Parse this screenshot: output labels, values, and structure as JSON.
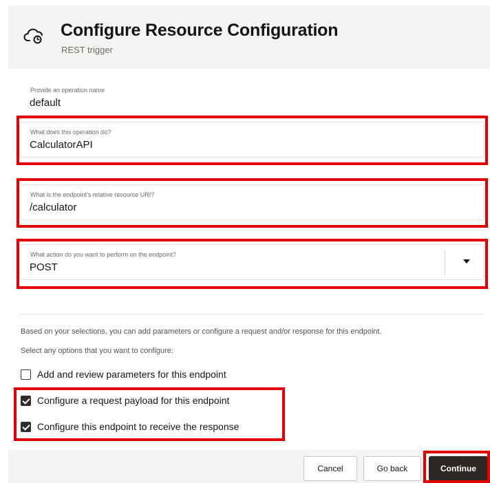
{
  "header": {
    "title": "Configure Resource Configuration",
    "subtitle": "REST trigger",
    "icon": "rest-cloud-icon"
  },
  "fields": {
    "operation_name": {
      "label": "Provide an operation name",
      "value": "default"
    },
    "operation_description": {
      "label": "What does this operation do?",
      "value": "CalculatorAPI"
    },
    "resource_uri": {
      "label": "What is the endpoint's relative resource URI?",
      "value": "/calculator"
    },
    "action": {
      "label": "What action do you want to perform on the endpoint?",
      "value": "POST",
      "icon": "chevron-down-icon"
    }
  },
  "options": {
    "info": "Based on your selections, you can add parameters or configure a request and/or response for this endpoint.",
    "prompt": "Select any options that you want to configure:",
    "items": [
      {
        "label": "Add and review parameters for this endpoint",
        "checked": false
      },
      {
        "label": "Configure a request payload for this endpoint",
        "checked": true
      },
      {
        "label": "Configure this endpoint to receive the response",
        "checked": true
      }
    ]
  },
  "footer": {
    "cancel_label": "Cancel",
    "back_label": "Go back",
    "continue_label": "Continue"
  },
  "colors": {
    "highlight": "#e30000",
    "primary_button": "#2b2826",
    "header_bg": "#f5f4f2"
  }
}
